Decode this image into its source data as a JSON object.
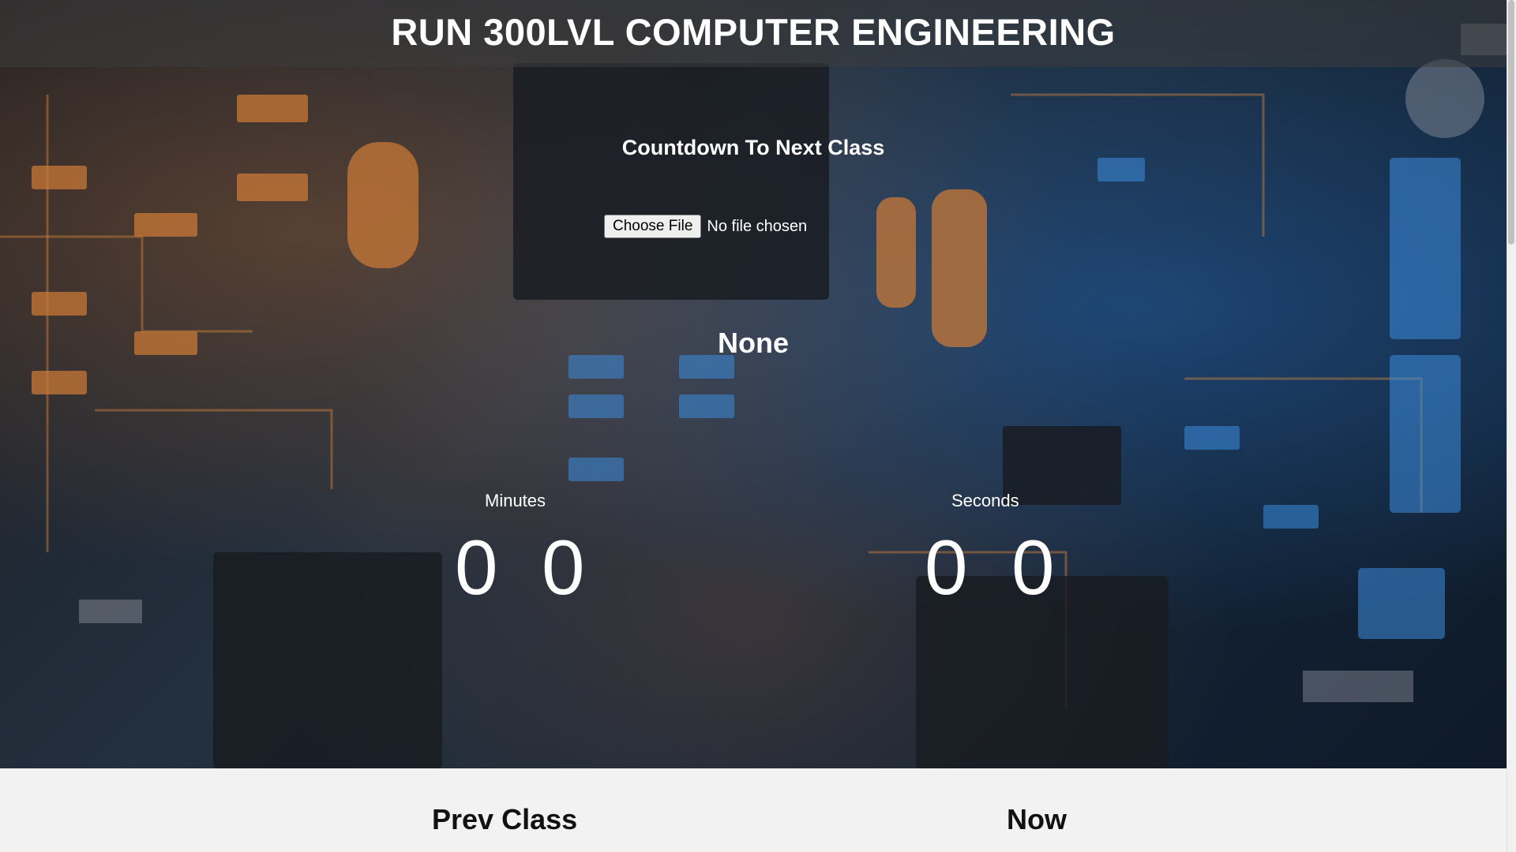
{
  "header": {
    "title": "RUN 300LVL COMPUTER ENGINEERING"
  },
  "countdown": {
    "label": "Countdown To Next Class",
    "file_button": "Choose File",
    "file_status": "No file chosen",
    "class_name": "None",
    "minutes_label": "Minutes",
    "seconds_label": "Seconds",
    "minutes_digits": [
      "0",
      "0"
    ],
    "seconds_digits": [
      "0",
      "0"
    ]
  },
  "schedule": {
    "prev_label": "Prev Class",
    "now_label": "Now"
  }
}
